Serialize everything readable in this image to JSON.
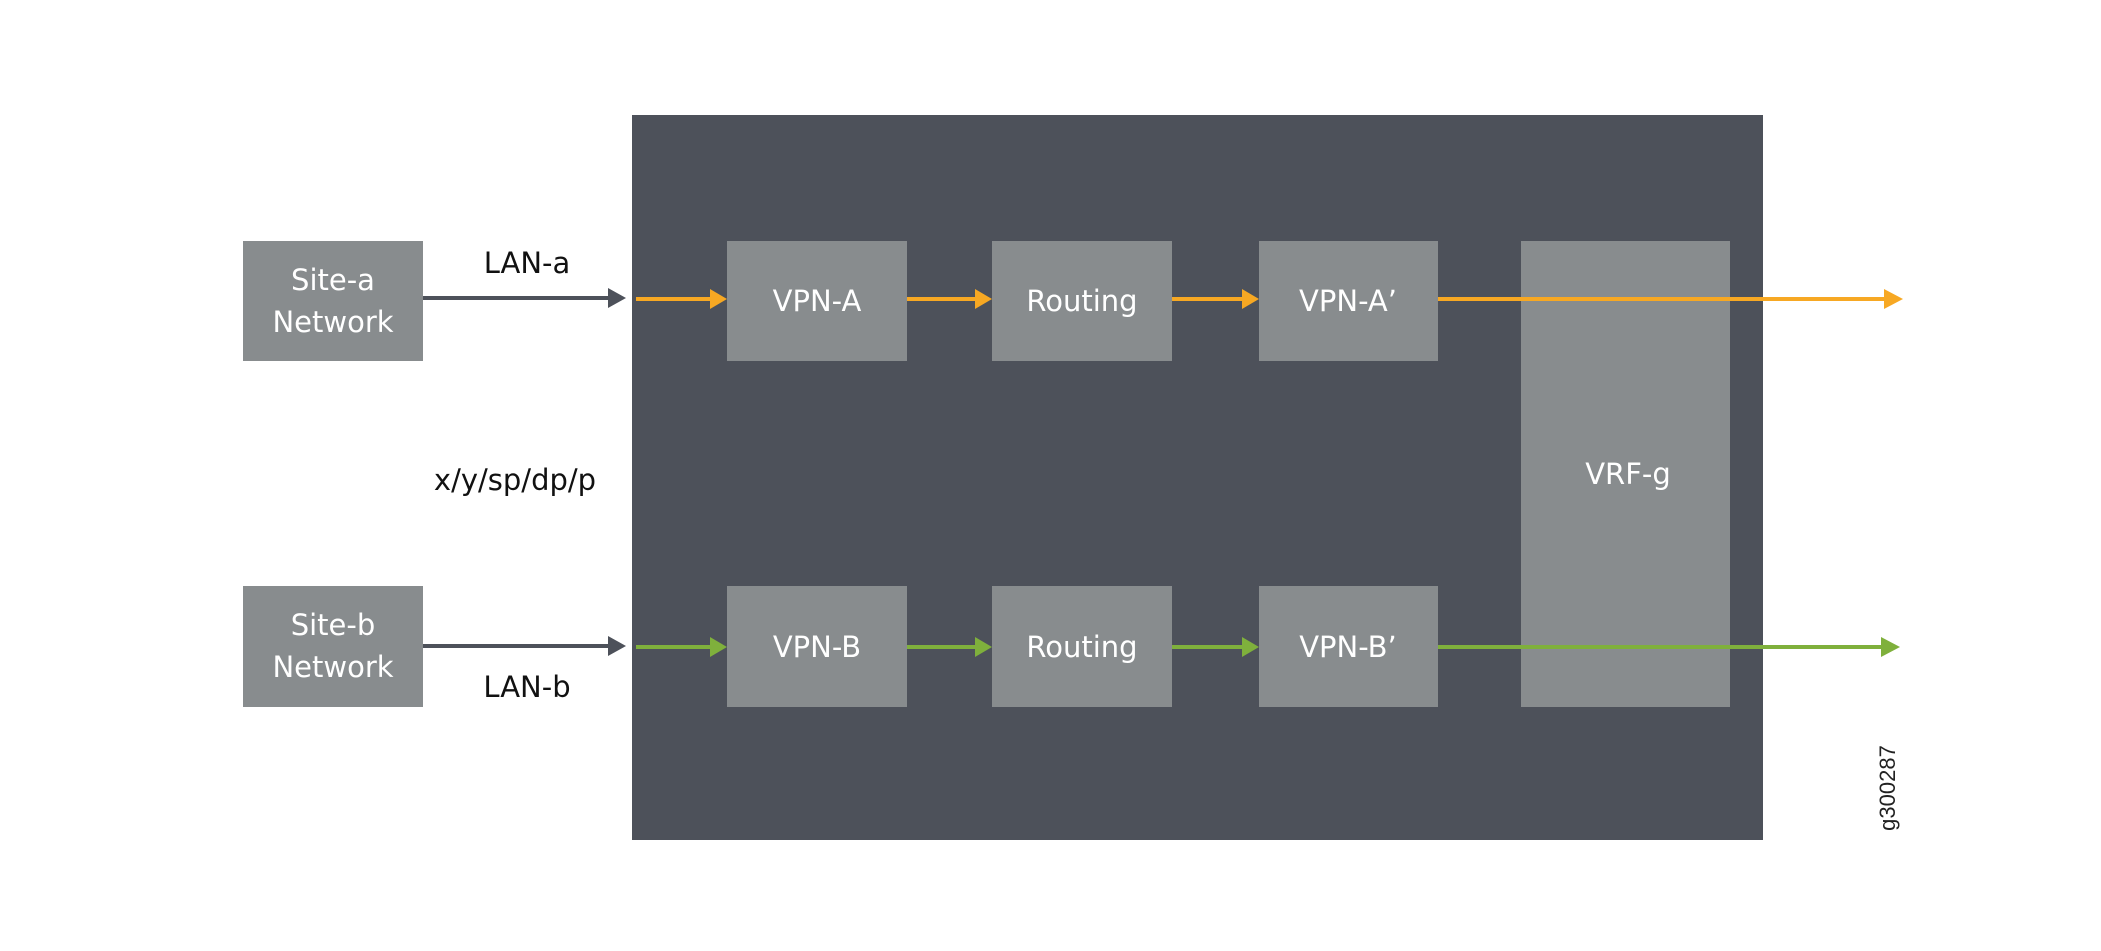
{
  "diagram": {
    "colors": {
      "panel": "#4d515a",
      "box": "#888c8e",
      "lan_arrow": "#4d515a",
      "flow_a": "#f7a823",
      "flow_b": "#7fb03c",
      "box_text": "#ffffff",
      "label_text": "#111111"
    },
    "sites": {
      "a": {
        "line1": "Site-a",
        "line2": "Network"
      },
      "b": {
        "line1": "Site-b",
        "line2": "Network"
      }
    },
    "links": {
      "a": "LAN-a",
      "b": "LAN-b"
    },
    "interface_label": "x/y/sp/dp/p",
    "flow_a": {
      "stages": [
        "VPN-A",
        "Routing",
        "VPN-A’"
      ]
    },
    "flow_b": {
      "stages": [
        "VPN-B",
        "Routing",
        "VPN-B’"
      ]
    },
    "vrf_label": "VRF-g",
    "figure_id": "g300287"
  }
}
